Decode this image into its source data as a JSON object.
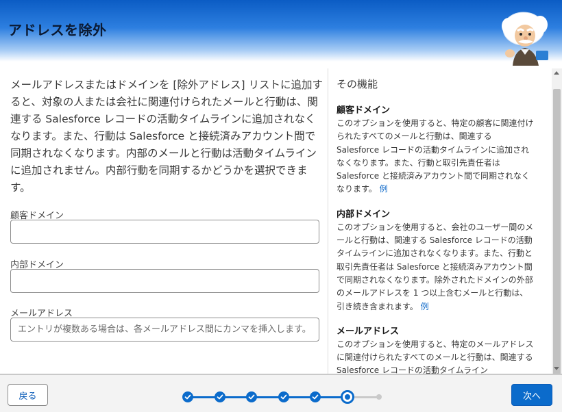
{
  "modal": {
    "title": "アドレスを除外"
  },
  "form": {
    "intro": "メールアドレスまたはドメインを [除外アドレス] リストに追加すると、対象の人または会社に関連付けられたメールと行動は、関連する Salesforce レコードの活動タイムラインに追加されなくなります。また、行動は Salesforce と接続済みアカウント間で同期されなくなります。内部のメールと行動は活動タイムラインに追加されません。内部行動を同期するかどうかを選択できます。",
    "customer_domain_label": "顧客ドメイン",
    "customer_domain_value": "",
    "internal_domain_label": "内部ドメイン",
    "internal_domain_value": "",
    "email_label": "メールアドレス",
    "email_value": "",
    "email_placeholder": "エントリが複数ある場合は、各メールアドレス間にカンマを挿入します。"
  },
  "help": {
    "title": "その機能",
    "sections": [
      {
        "heading": "顧客ドメイン",
        "body": "このオプションを使用すると、特定の顧客に関連付けられたすべてのメールと行動は、関連する Salesforce レコードの活動タイムラインに追加されなくなります。また、行動と取引先責任者は Salesforce と接続済みアカウント間で同期されなくなります。",
        "link": "例"
      },
      {
        "heading": "内部ドメイン",
        "body": "このオプションを使用すると、会社のユーザー間のメールと行動は、関連する Salesforce レコードの活動タイムラインに追加されなくなります。また、行動と取引先責任者は Salesforce と接続済みアカウント間で同期されなくなります。除外されたドメインの外部のメールアドレスを 1 つ以上含むメールと行動は、引き続き含まれます。",
        "link": "例"
      },
      {
        "heading": "メールアドレス",
        "body": "このオプションを使用すると、特定のメールアドレスに関連付けられたすべてのメールと行動は、関連する Salesforce レコードの活動タイムライン",
        "link": ""
      }
    ]
  },
  "footer": {
    "back_label": "戻る",
    "next_label": "次へ",
    "steps_total": 7,
    "steps_completed": 5,
    "current_step": 6
  },
  "colors": {
    "brand": "#0b6bcb",
    "header_top": "#0b5cc4",
    "link": "#0b68c9"
  },
  "icons": {
    "mascot": "einstein-mascot-icon",
    "step_done": "check-icon"
  }
}
